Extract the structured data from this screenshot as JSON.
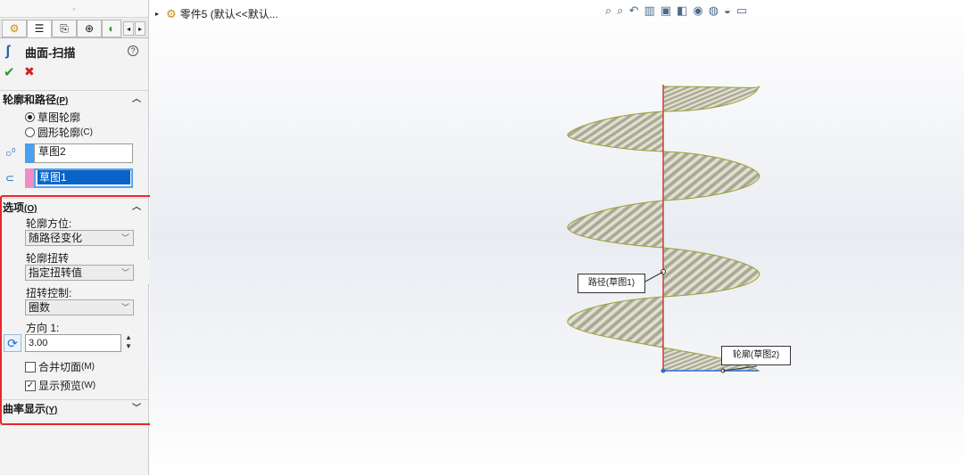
{
  "panel": {
    "tabs": [
      {
        "name": "feature-manager",
        "glyph": "⚙"
      },
      {
        "name": "property-manager",
        "glyph": "☰"
      },
      {
        "name": "configuration-manager",
        "glyph": "⎘"
      },
      {
        "name": "dimxpert-manager",
        "glyph": "⊕"
      },
      {
        "name": "display-manager",
        "glyph": "◐"
      }
    ],
    "feature_title": "曲面-扫描",
    "help": "?",
    "ok": "✔",
    "cancel": "✖"
  },
  "profile_path": {
    "header": "轮廓和路径",
    "header_key": "(P)",
    "radio_sketch": "草图轮廓",
    "radio_circle": "圆形轮廓",
    "radio_circle_key": "(C)",
    "profile_value": "草图2",
    "path_value": "草图1",
    "profile_color": "#4a9ff0",
    "path_color": "#f08cc8"
  },
  "options": {
    "header": "选项",
    "header_key": "(O)",
    "orientation_label": "轮廓方位:",
    "orientation_value": "随路径变化",
    "twist_label": "轮廓扭转",
    "twist_value": "指定扭转值",
    "twist_control_label": "扭转控制:",
    "twist_control_value": "圈数",
    "direction_label": "方向 1:",
    "direction_value": "3.00",
    "merge_label": "合并切面",
    "merge_key": "(M)",
    "merge_checked": false,
    "preview_label": "显示预览",
    "preview_key": "(W)",
    "preview_checked": true
  },
  "curvature": {
    "header": "曲率显示",
    "header_key": "(Y)"
  },
  "viewport": {
    "tree_label": "零件5  (默认<<默认...",
    "path_callout": "路径(草图1)",
    "profile_callout": "轮廓(草图2)",
    "highlight_color": "#e8262c"
  }
}
